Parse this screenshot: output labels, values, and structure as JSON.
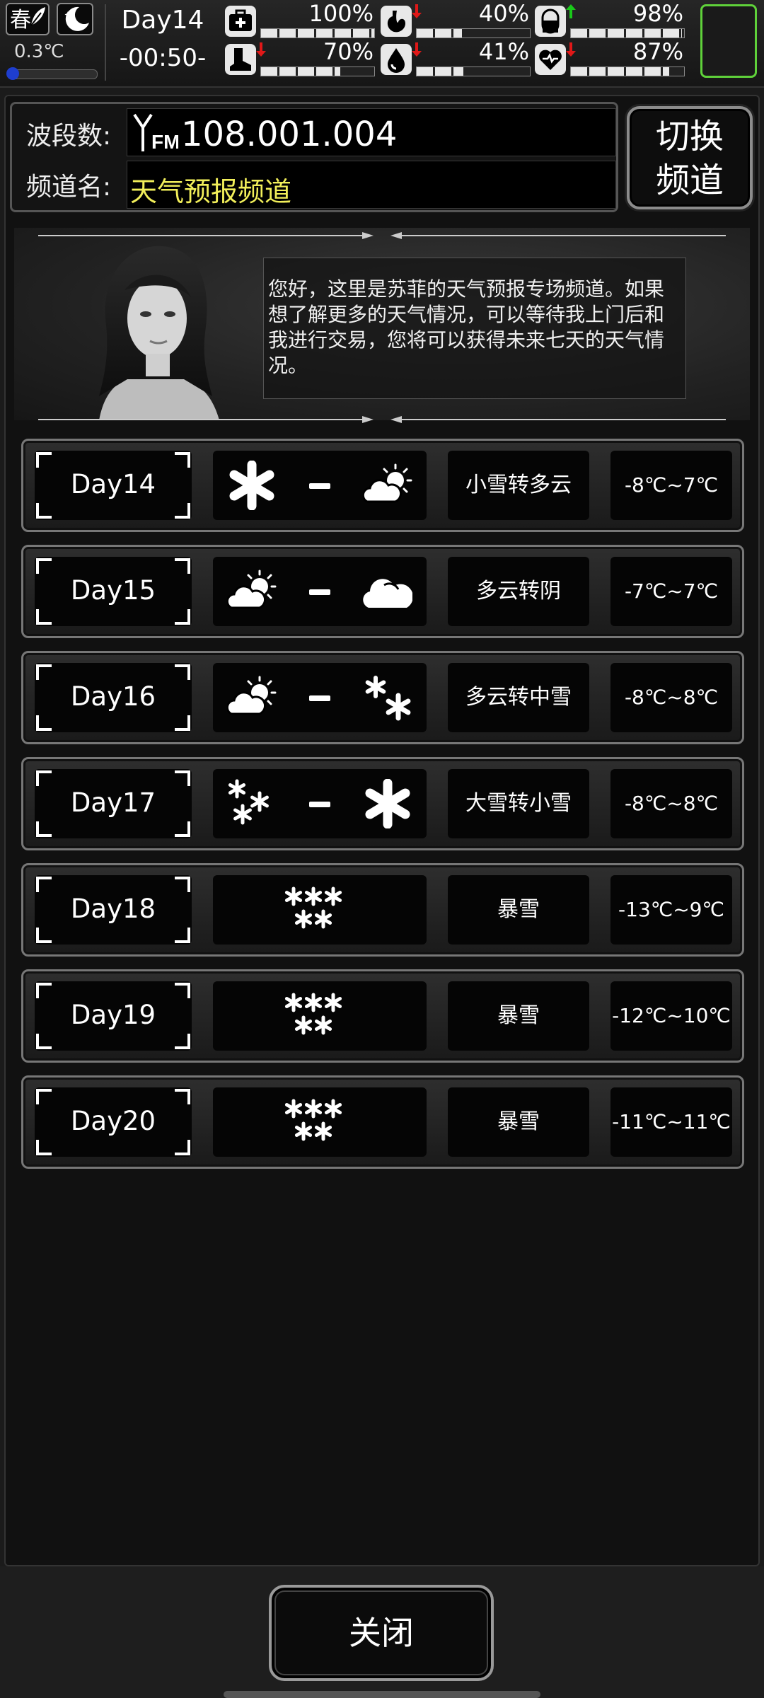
{
  "status": {
    "season": "春",
    "temperature": "0.3℃",
    "temperature_level": 0.0,
    "day": "Day14",
    "time": "-00:50-",
    "stats": [
      {
        "name": "health",
        "icon": "medkit-icon",
        "value": "100%",
        "level": 1.0,
        "trend": "none"
      },
      {
        "name": "hunger",
        "icon": "stomach-icon",
        "value": "40%",
        "level": 0.4,
        "trend": "down"
      },
      {
        "name": "medicine",
        "icon": "pill-icon",
        "value": "98%",
        "level": 0.98,
        "trend": "up"
      },
      {
        "name": "stamina",
        "icon": "boot-icon",
        "value": "70%",
        "level": 0.7,
        "trend": "down"
      },
      {
        "name": "thirst",
        "icon": "water-drop-icon",
        "value": "41%",
        "level": 0.41,
        "trend": "down"
      },
      {
        "name": "mood",
        "icon": "heart-icon",
        "value": "87%",
        "level": 0.87,
        "trend": "down"
      }
    ],
    "colors": {
      "up": "#19c919",
      "down": "#e01818",
      "slot_border": "#5fd13a"
    }
  },
  "radio": {
    "freq_label": "波段数:",
    "freq_value": "108.001.004",
    "fm_mark": "FM",
    "channel_label": "频道名:",
    "channel_value": "天气预报频道",
    "switch_button": "切换频道",
    "switch_line1": "切换",
    "switch_line2": "频道",
    "channel_color": "#f2ef5a"
  },
  "announcer": {
    "message": "您好，这里是苏菲的天气预报专场频道。如果想了解更多的天气情况，可以等待我上门后和我进行交易，您将可以获得未来七天的天气情况。"
  },
  "forecast": [
    {
      "day": "Day14",
      "icon_from": "snowflake-icon",
      "icon_to": "partly-cloudy-icon",
      "desc": "小雪转多云",
      "temp": "-8℃~7℃"
    },
    {
      "day": "Day15",
      "icon_from": "partly-cloudy-icon",
      "icon_to": "cloud-icon",
      "desc": "多云转阴",
      "temp": "-7℃~7℃"
    },
    {
      "day": "Day16",
      "icon_from": "partly-cloudy-icon",
      "icon_to": "medium-snow-icon",
      "desc": "多云转中雪",
      "temp": "-8℃~8℃"
    },
    {
      "day": "Day17",
      "icon_from": "heavy-snow-icon",
      "icon_to": "snowflake-icon",
      "desc": "大雪转小雪",
      "temp": "-8℃~8℃"
    },
    {
      "day": "Day18",
      "icon_single": "blizzard-icon",
      "desc": "暴雪",
      "temp": "-13℃~9℃"
    },
    {
      "day": "Day19",
      "icon_single": "blizzard-icon",
      "desc": "暴雪",
      "temp": "-12℃~10℃"
    },
    {
      "day": "Day20",
      "icon_single": "blizzard-icon",
      "desc": "暴雪",
      "temp": "-11℃~11℃"
    }
  ],
  "close_button": "关闭"
}
